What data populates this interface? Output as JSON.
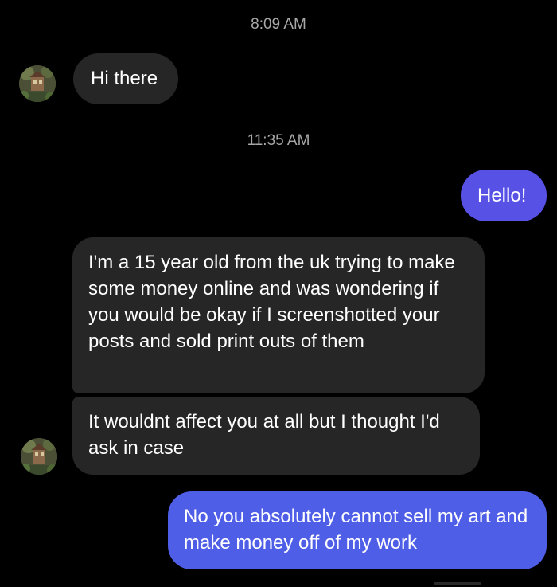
{
  "conversation": {
    "timestamps": [
      "8:09 AM",
      "11:35 AM"
    ],
    "messages": [
      {
        "side": "incoming",
        "text": "Hi there"
      },
      {
        "side": "outgoing",
        "text": "Hello!"
      },
      {
        "side": "incoming",
        "text": "I'm a 15 year old from the uk trying to make some money online and was wondering if you would be okay if I screenshotted your posts and sold print outs of them"
      },
      {
        "side": "incoming",
        "text": "It wouldnt affect you at all but I thought I'd ask in case"
      },
      {
        "side": "outgoing",
        "text": "No you absolutely cannot sell my art and make money off of my work"
      }
    ]
  },
  "colors": {
    "background": "#000000",
    "incoming_bubble": "#262626",
    "outgoing_bubble": "#5851e6",
    "timestamp_text": "#a8a8a8"
  },
  "icons": {
    "contact_avatar": "avatar-thumbnail"
  }
}
